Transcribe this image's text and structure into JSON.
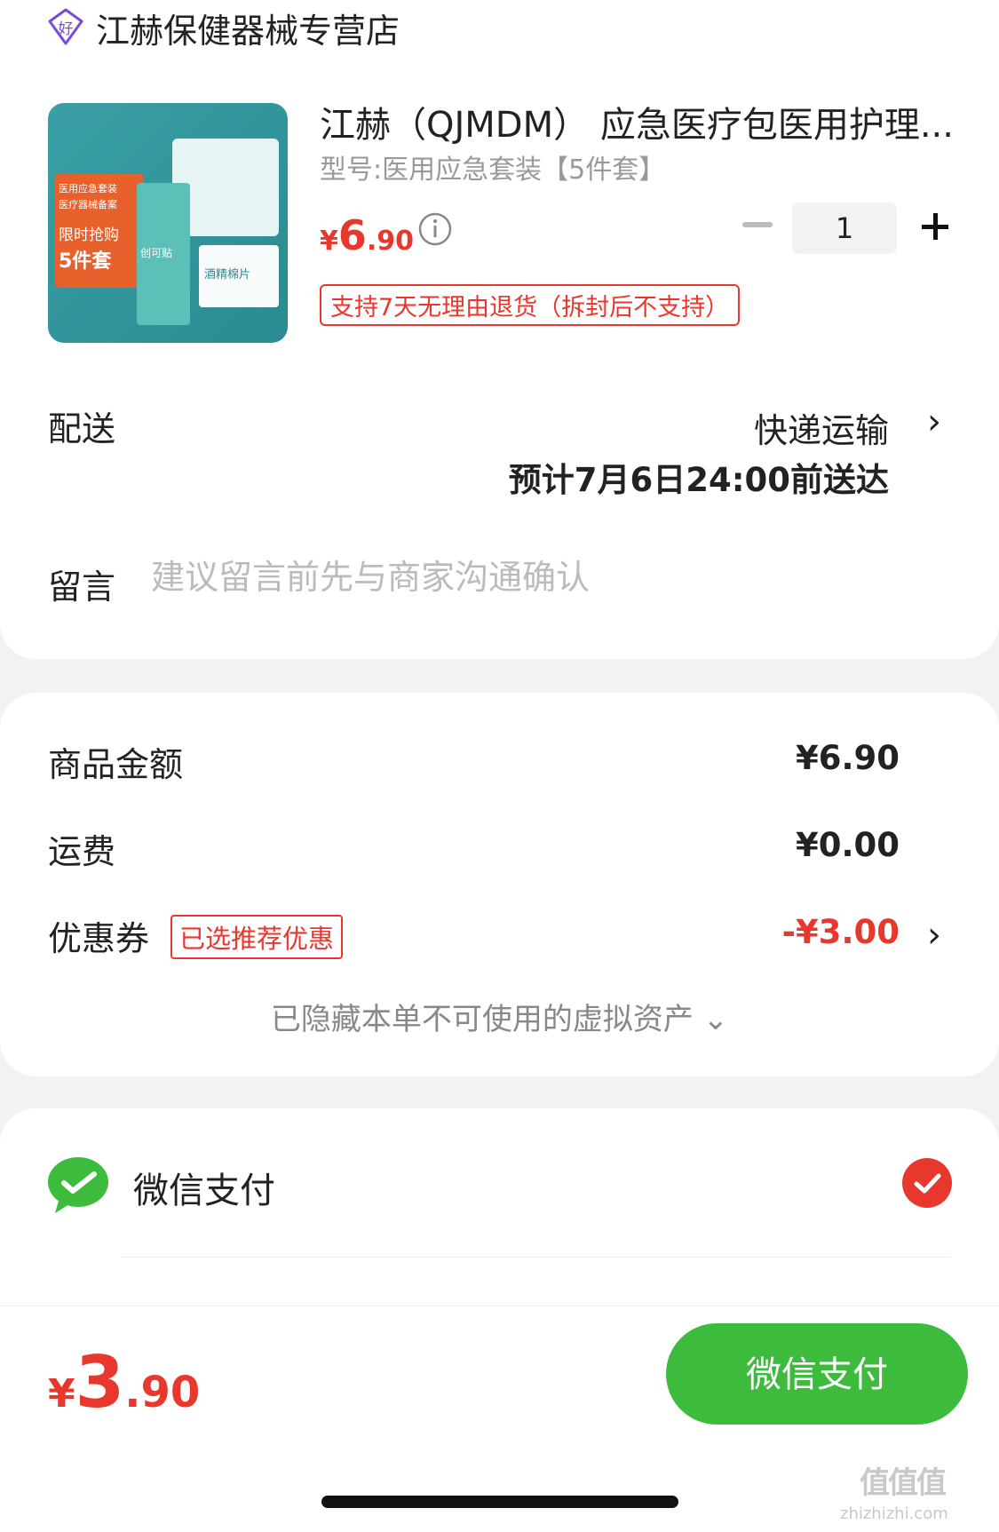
{
  "store": {
    "name": "江赫保健器械专营店",
    "icon": "shop-badge-icon"
  },
  "product": {
    "title": "江赫（QJMDM） 应急医疗包医用护理...",
    "variant": "型号:医用应急套装【5件套】",
    "price_currency": "¥",
    "price_int": "6",
    "price_dec": ".90",
    "return_policy": "支持7天无理由退货（拆封后不支持）",
    "thumb_labels": {
      "l1": "医用应急套装",
      "l2": "医疗器械备案",
      "l3": "限时抢购",
      "l4": "5件套",
      "l5": "创可贴",
      "l6": "酒精棉片"
    }
  },
  "quantity": {
    "value": "1"
  },
  "shipping": {
    "label": "配送",
    "method": "快递运输",
    "eta": "预计7月6日24:00前送达"
  },
  "message": {
    "label": "留言",
    "placeholder": "建议留言前先与商家沟通确认"
  },
  "summary": {
    "goods_label": "商品金额",
    "goods_value": "¥6.90",
    "freight_label": "运费",
    "freight_value": "¥0.00",
    "coupon_label": "优惠券",
    "coupon_tag": "已选推荐优惠",
    "coupon_value": "-¥3.00",
    "hidden_assets": "已隐藏本单不可使用的虚拟资产 ⌄"
  },
  "payment": {
    "method": "微信支付",
    "selected": true
  },
  "footer": {
    "total_currency": "¥",
    "total_int": "3",
    "total_dec": ".90",
    "pay_button": "微信支付"
  },
  "watermark": {
    "main": "值值值",
    "sub": "zhizhizhi.com"
  },
  "colors": {
    "accent_red": "#e8372c",
    "wechat_green": "#3dbb3d"
  }
}
